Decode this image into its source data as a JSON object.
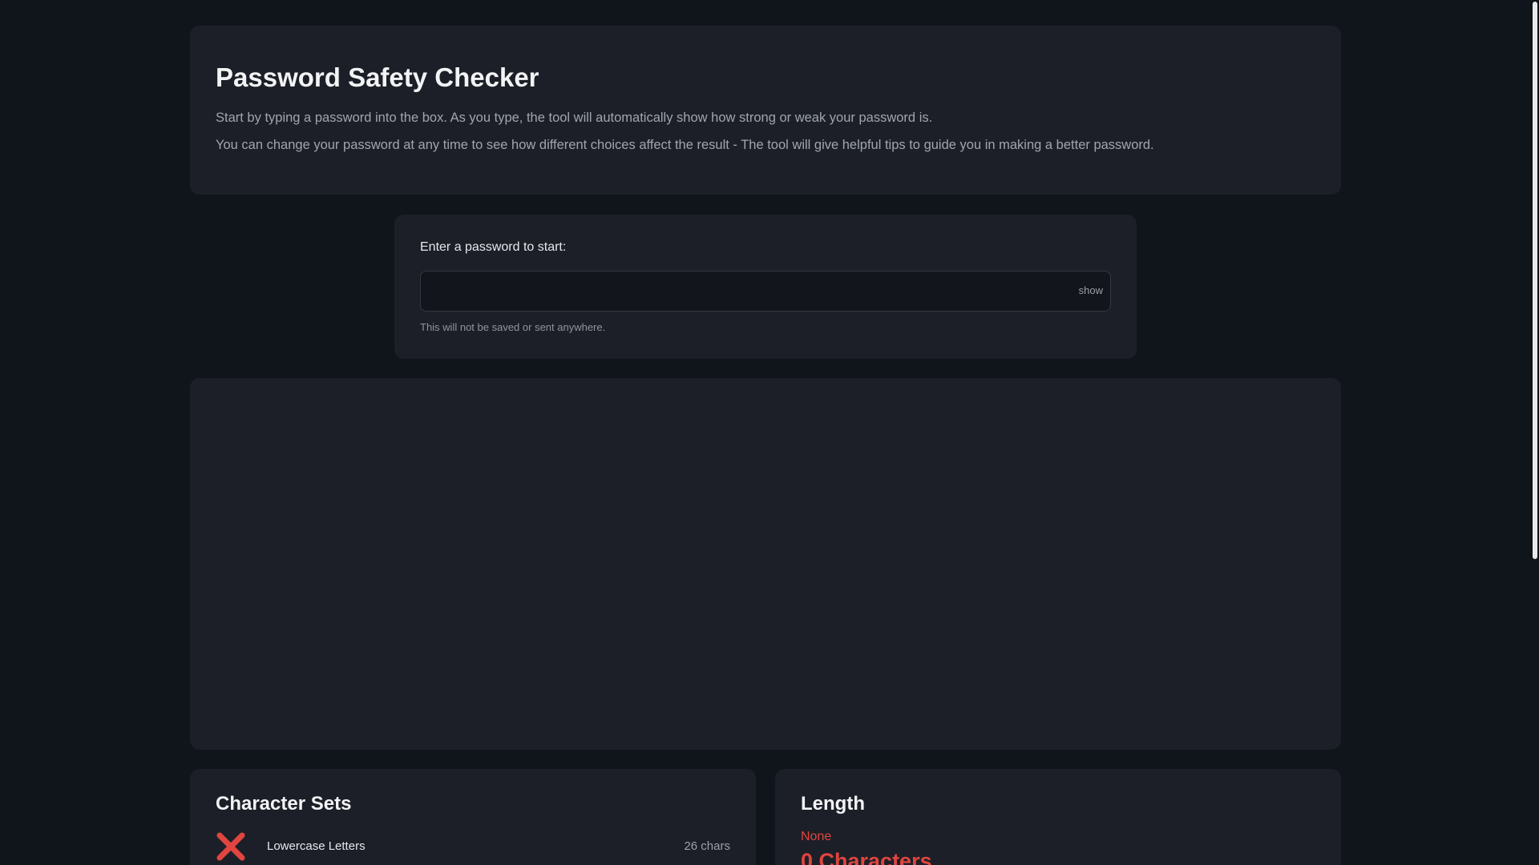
{
  "intro": {
    "title": "Password Safety Checker",
    "paragraph1": "Start by typing a password into the box. As you type, the tool will automatically show how strong or weak your password is.",
    "paragraph2": "You can change your password at any time to see how different choices affect the result - The tool will give helpful tips to guide you in making a better password."
  },
  "password_input": {
    "label": "Enter a password to start:",
    "value": "",
    "toggle_label": "show",
    "hint": "This will not be saved or sent anywhere."
  },
  "character_sets": {
    "title": "Character Sets",
    "items": [
      {
        "name": "Lowercase Letters",
        "count": "26 chars",
        "status": "missing",
        "icon": "cross-icon"
      }
    ]
  },
  "length": {
    "title": "Length",
    "rating": "None",
    "value": "0 Characters"
  },
  "colors": {
    "background": "#10141b",
    "card": "#1c1f27",
    "danger": "#e0453f"
  }
}
